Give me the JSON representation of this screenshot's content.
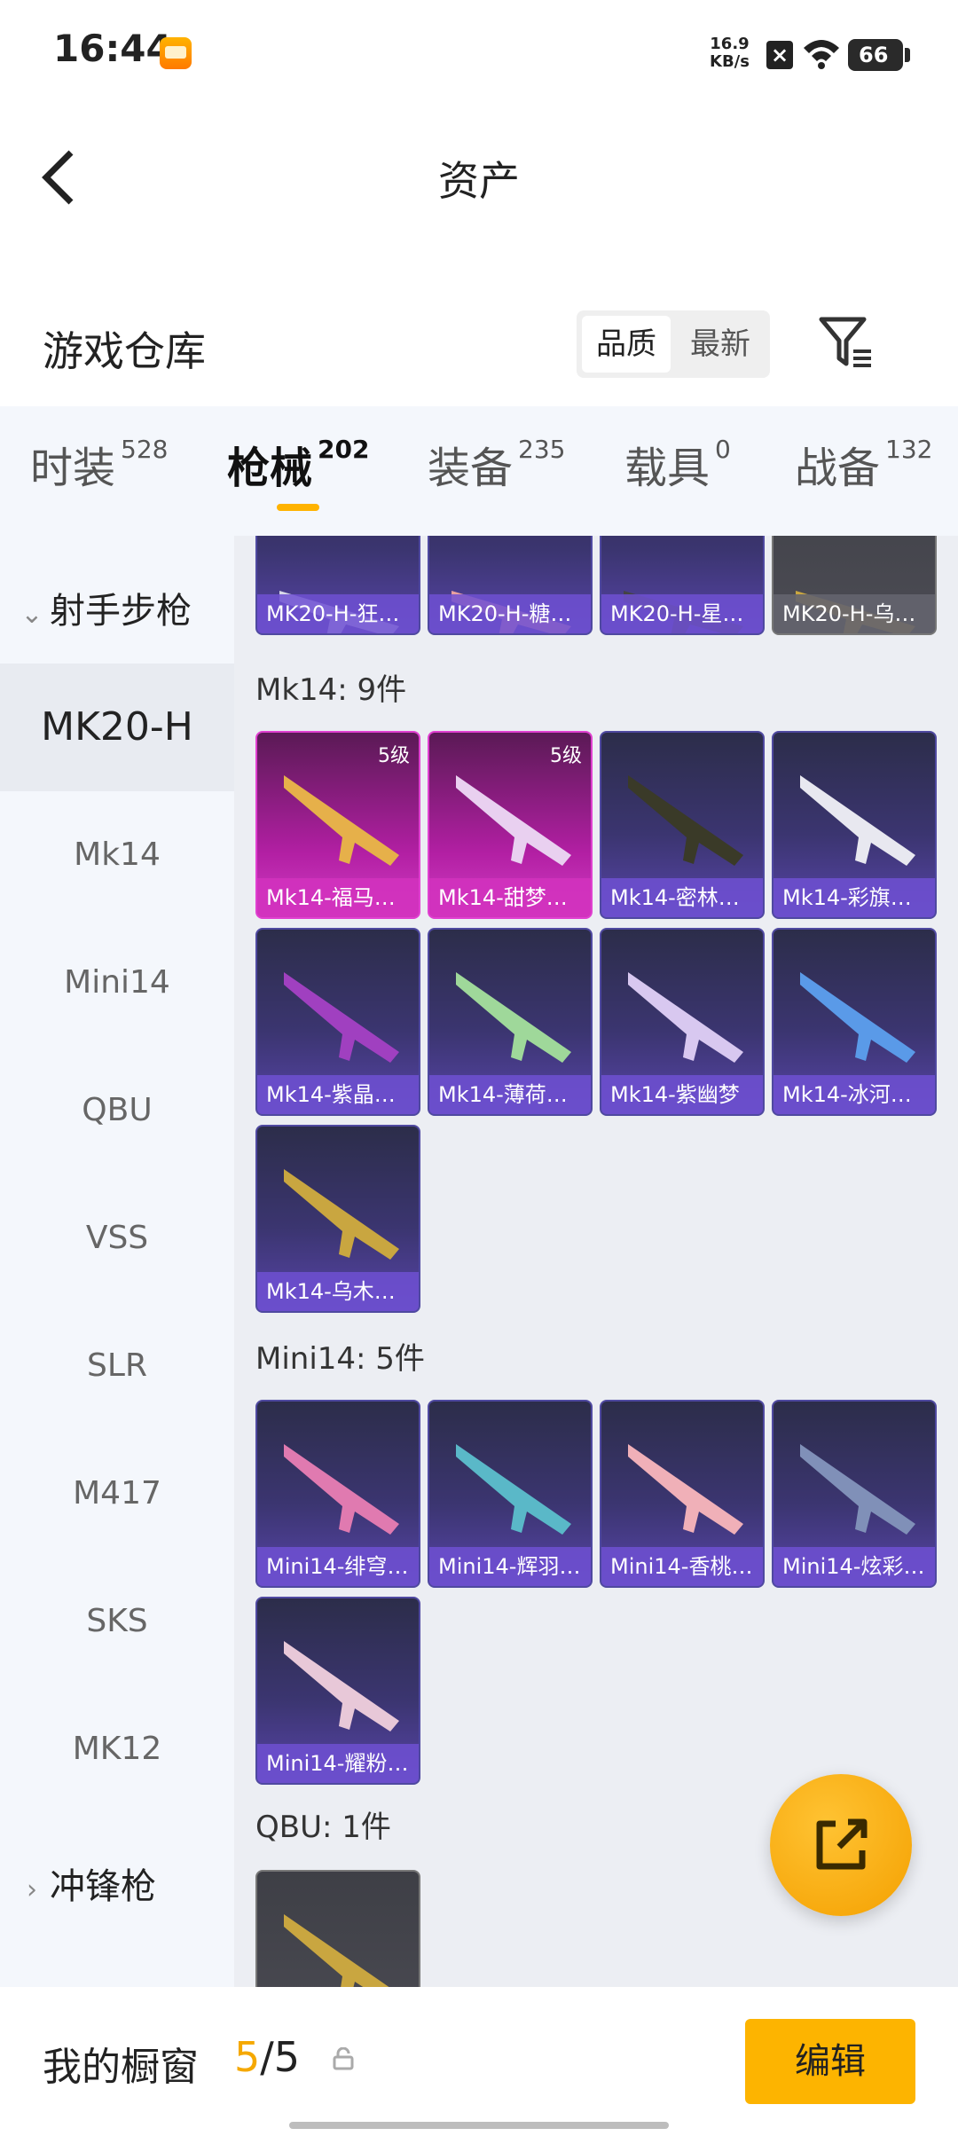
{
  "status_bar": {
    "time": "16:44",
    "net_speed_value": "16.9",
    "net_speed_unit": "KB/s",
    "battery": "66"
  },
  "header": {
    "title": "资产",
    "back_icon": "chevron-left-icon"
  },
  "warehouse": {
    "title": "游戏仓库",
    "sort_options": [
      "品质",
      "最新"
    ],
    "sort_selected": "品质",
    "filter_icon": "filter-icon"
  },
  "tabs": [
    {
      "label": "时装",
      "count": "528"
    },
    {
      "label": "枪械",
      "count": "202",
      "active": true
    },
    {
      "label": "装备",
      "count": "235"
    },
    {
      "label": "载具",
      "count": "0"
    },
    {
      "label": "战备",
      "count": "132"
    }
  ],
  "sidebar": {
    "group_open": "射手步枪",
    "items": [
      "MK20-H",
      "Mk14",
      "Mini14",
      "QBU",
      "VSS",
      "SLR",
      "M417",
      "SKS",
      "MK12"
    ],
    "active_item": "MK20-H",
    "group_closed": "冲锋枪"
  },
  "sections": [
    {
      "title": "",
      "cards": [
        {
          "name": "MK20-H-狂…",
          "style": "purple"
        },
        {
          "name": "MK20-H-糖…",
          "style": "purple"
        },
        {
          "name": "MK20-H-星…",
          "style": "purple"
        },
        {
          "name": "MK20-H-乌…",
          "style": "gray"
        }
      ]
    },
    {
      "title": "Mk14: 9件",
      "cards": [
        {
          "name": "Mk14-福马…",
          "style": "pink",
          "level": "5级"
        },
        {
          "name": "Mk14-甜梦…",
          "style": "pink",
          "level": "5级"
        },
        {
          "name": "Mk14-密林…",
          "style": "purple"
        },
        {
          "name": "Mk14-彩旗…",
          "style": "purple"
        },
        {
          "name": "Mk14-紫晶…",
          "style": "purple"
        },
        {
          "name": "Mk14-薄荷…",
          "style": "purple"
        },
        {
          "name": "Mk14-紫幽梦",
          "style": "purple"
        },
        {
          "name": "Mk14-冰河…",
          "style": "purple"
        },
        {
          "name": "Mk14-乌木…",
          "style": "purple"
        }
      ]
    },
    {
      "title": "Mini14: 5件",
      "cards": [
        {
          "name": "Mini14-绯穹…",
          "style": "purple"
        },
        {
          "name": "Mini14-辉羽…",
          "style": "purple"
        },
        {
          "name": "Mini14-香桃…",
          "style": "purple"
        },
        {
          "name": "Mini14-炫彩…",
          "style": "purple"
        },
        {
          "name": "Mini14-耀粉…",
          "style": "purple"
        }
      ]
    },
    {
      "title": "QBU: 1件",
      "cards": [
        {
          "name": "",
          "style": "gray"
        }
      ]
    }
  ],
  "fab_icon": "share-external-icon",
  "bottom": {
    "showcase_label": "我的橱窗",
    "showcase_current": "5",
    "showcase_sep": "/",
    "showcase_total": "5",
    "lock_icon": "lock-icon",
    "edit_label": "编辑"
  },
  "colors": {
    "accent": "#fdb400",
    "tab_indicator": "#ffb300",
    "card_purple": "#3b3570",
    "card_pink": "#b21fa3"
  }
}
